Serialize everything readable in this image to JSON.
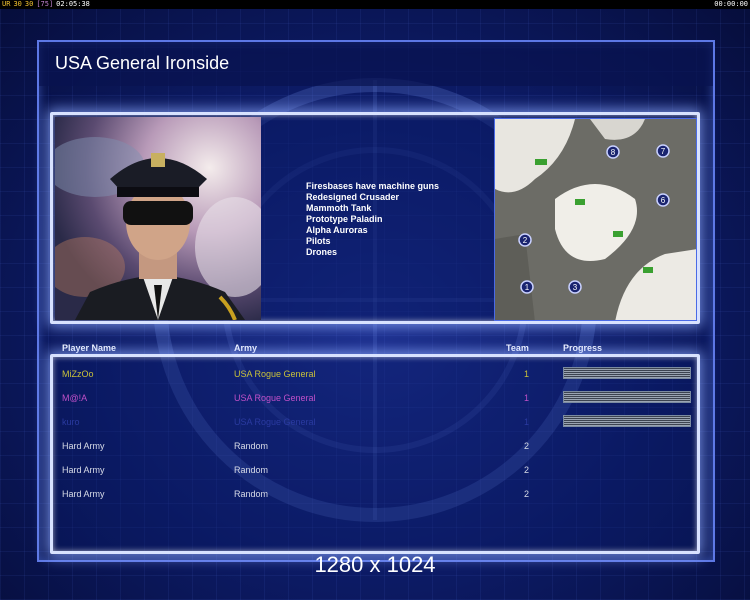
{
  "top_bar": {
    "stats": [
      {
        "label": "UR",
        "color": "#f2c230"
      },
      {
        "label": "30",
        "color": "#f2c230"
      },
      {
        "label": "30",
        "color": "#f2c230"
      },
      {
        "label": "[75]",
        "color": "#c080d0"
      },
      {
        "label": "02:05:38",
        "color": "#ffffff"
      }
    ],
    "clock_right": "00:00:00"
  },
  "title": "USA General Ironside",
  "features": [
    "Firesbases have machine guns",
    "Redesigned Crusader",
    "Mammoth Tank",
    "Prototype Paladin",
    "Alpha Auroras",
    "Pilots",
    "Drones"
  ],
  "map": {
    "start_positions": [
      "1",
      "2",
      "3",
      "6",
      "7",
      "8"
    ]
  },
  "columns": {
    "player": "Player Name",
    "army": "Army",
    "team": "Team",
    "progress": "Progress"
  },
  "players": [
    {
      "name": "MiZzOo",
      "army": "USA Rogue General",
      "team": "1",
      "color": "#c9c13a",
      "army_color": "#c9c13a",
      "progress": 1.0
    },
    {
      "name": "M@!A",
      "army": "USA Rogue General",
      "team": "1",
      "color": "#c050c8",
      "army_color": "#c050c8",
      "progress": 1.0
    },
    {
      "name": "kuro",
      "army": "USA Rogue General",
      "team": "1",
      "color": "#2a3aa0",
      "army_color": "#2a3aa0",
      "progress": 1.0
    },
    {
      "name": "Hard Army",
      "army": "Random",
      "team": "2",
      "color": "#d8dce8",
      "army_color": "#d8dce8",
      "progress": null
    },
    {
      "name": "Hard Army",
      "army": "Random",
      "team": "2",
      "color": "#d8dce8",
      "army_color": "#d8dce8",
      "progress": null
    },
    {
      "name": "Hard Army",
      "army": "Random",
      "team": "2",
      "color": "#d8dce8",
      "army_color": "#d8dce8",
      "progress": null
    }
  ],
  "resolution": "1280 x 1024"
}
